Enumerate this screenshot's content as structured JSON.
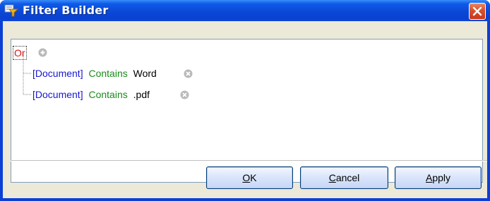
{
  "window": {
    "title": "Filter Builder"
  },
  "colors": {
    "title_bar": "#0a48d8",
    "close_button": "#d9542f",
    "group_operator": "#d41414",
    "field": "#1818d0",
    "operator": "#1b8a1b",
    "value": "#000000"
  },
  "filter": {
    "group_operator": "Or",
    "conditions": [
      {
        "field": "[Document]",
        "operator": "Contains",
        "value": "Word"
      },
      {
        "field": "[Document]",
        "operator": "Contains",
        "value": ".pdf"
      }
    ]
  },
  "icons": {
    "title": "filter-icon",
    "close": "close-icon",
    "add": "plus-circle-icon",
    "remove": "remove-circle-icon"
  },
  "buttons": {
    "ok": {
      "mnemonic": "O",
      "rest": "K"
    },
    "cancel": {
      "mnemonic": "C",
      "rest": "ancel"
    },
    "apply": {
      "mnemonic": "A",
      "rest": "pply"
    }
  }
}
